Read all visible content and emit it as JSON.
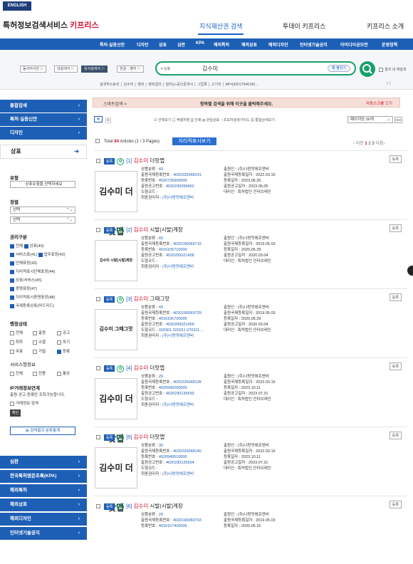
{
  "topbar": {
    "lang": "ENGLISH"
  },
  "header": {
    "logo_main": "특허정보검색서비스",
    "logo_brand": "키프리스",
    "nav": [
      "지식재산권 검색",
      "투데이 키프리스",
      "키프리스 소개"
    ]
  },
  "menubar": {
    "items": [
      "특허·실용신안",
      "디자인",
      "상표",
      "심판",
      "KPA",
      "해외특허",
      "해외상표",
      "해외디자인",
      "인터넷기술공지",
      "아이디어공모전",
      "운영정책"
    ]
  },
  "search": {
    "scopes": [
      "동의어사전 ▷",
      "내검색식 ▷",
      "유사검색식 ▷",
      "한글→영어 ▷"
    ],
    "field_select": "▾ 상표",
    "query": "김수미",
    "expand": "확 펼치기",
    "in_result": "결과 내 재검색",
    "history": "검색히스토리 │ 김수미 │ 영락 │ 영락걸리 │ 덜리는•공인중개사 │ 그립톡 │ 고기리 │ AP=[42017044190...",
    "history_nav": "〈 〉"
  },
  "sidebar": {
    "top_items": [
      "통합검색",
      "특허·실용신안",
      "디자인"
    ],
    "active": "상표",
    "type_title": "유형",
    "type_select": "상표유형을 선택하세요",
    "sort_title": "정렬",
    "sort1": "선택",
    "sort2": "선택",
    "rights_title": "권리구분",
    "rights": [
      [
        "전체",
        "상표(40)"
      ],
      [
        "서비스표(41)",
        "업무표장(42)"
      ],
      [
        "단체표장(43)"
      ],
      [
        "지리적표시단체표장(44)"
      ],
      [
        "상표/서비스(45)"
      ],
      [
        "증명표장(47)"
      ],
      [
        "지리적표시증명표장(48)"
      ],
      [
        "국제등록상표(마드리드)"
      ]
    ],
    "status_title": "행정상태",
    "status": [
      [
        "전체",
        "출원",
        "공고"
      ],
      [
        "취하",
        "소멸",
        "포기"
      ],
      [
        "무효",
        "거절",
        "등록"
      ]
    ],
    "design_title": "서비스형정보",
    "design": [
      "전체",
      "전용",
      "통상"
    ],
    "ip_title": "IP거래정보연계",
    "ip_desc": "출원·공고·등록만 조회가능합니다.",
    "ip_check": "거래정보 검색",
    "confirm": "확인",
    "stat_btn": "검색결과 분류통계",
    "bottom_items": [
      "심판",
      "한국특허영문초록(KPA)",
      "해외특허",
      "해외상표",
      "해외디자인",
      "인터넷기술공지"
    ]
  },
  "main": {
    "banner_left": "스마트검색 >",
    "banner_center": "항목별 검색을 위해 이곳을 클릭해주세요.",
    "banner_right": "자동스크롤 끄기",
    "tool_links": "☑ 선택보기 ▤ 엑셀저장 ⎙ 인쇄 ◍ 관심상표 ◔ 초보자검색가이드 ▦ 통합상세보기",
    "per_page": "페이지당 30개",
    "go": "GO",
    "total_prefix": "Total ",
    "total_count": "84",
    "total_suffix": " Articles (1 / 3 Pages)",
    "img_view": "지리적표시보기",
    "pager_prev": "‹ 이전",
    "pager_pages": "1",
    "pager_more": " 2 3",
    "pager_next": " 다음›"
  },
  "records": [
    {
      "num": "[1]",
      "name": "김수미",
      "rest": " 더맛맵",
      "status": "등록",
      "thumb": "김수미 더맛맵",
      "left": [
        [
          "상품분류 : ",
          "43"
        ],
        [
          "출원국제등록번호 : ",
          "4020220048141"
        ],
        [
          "등록번호 : ",
          "4020725600000"
        ],
        [
          "출원공고번호 : ",
          "4020230099462"
        ],
        [
          "도형코드 : ",
          ""
        ],
        [
          "최종권리자 : ",
          "(주)나랑맛에프앤비"
        ]
      ],
      "right": [
        [
          "출원인 : ",
          "(주)나랑맛에프앤비"
        ],
        [
          "출원국제등록일자 : ",
          "2022.03.16"
        ],
        [
          "등록일자 : ",
          "2023.06.25"
        ],
        [
          "출원공고일자 : ",
          "2023.06.05"
        ],
        [
          "대리인 : ",
          "특허법인 인터브레인"
        ]
      ]
    },
    {
      "num": "[2]",
      "name": "김수미",
      "rest": " 시발(시발)계장",
      "status": "등록",
      "thumb": "김수미 시발(시발)계장",
      "left": [
        [
          "상품분류 : ",
          "43"
        ],
        [
          "출원국제등록번호 : ",
          "4020190069715"
        ],
        [
          "등록번호 : ",
          "4016105710000"
        ],
        [
          "출원공고번호 : ",
          "4020200021458"
        ],
        [
          "도형코드 : ",
          ""
        ],
        [
          "최종권리자 : ",
          "(주)나랑맛에프앤비"
        ]
      ],
      "right": [
        [
          "출원인 : ",
          "(주)나랑맛에프앤비"
        ],
        [
          "출원국제등록일자 : ",
          "2019.05.03"
        ],
        [
          "등록일자 : ",
          "2020.05.29"
        ],
        [
          "출원공고일자 : ",
          "2020.03.04"
        ],
        [
          "대리인 : ",
          "특허법인 인터브레인"
        ]
      ]
    },
    {
      "num": "[3]",
      "name": "김수미",
      "rest": " 그때그맛",
      "status": "등록",
      "thumb": "김수미 그때그맛",
      "left": [
        [
          "상품분류 : ",
          "43"
        ],
        [
          "출원국제등록번호 : ",
          "4020190069729"
        ],
        [
          "등록번호 : ",
          "4016105720000"
        ],
        [
          "출원공고번호 : ",
          "4020200021459"
        ],
        [
          "도형코드 : ",
          "020301 020311 070311 ..."
        ],
        [
          "최종권리자 : ",
          "(주)나랑맛에프앤비"
        ]
      ],
      "right": [
        [
          "출원인 : ",
          "(주)나랑맛에프앤비"
        ],
        [
          "출원국제등록일자 : ",
          "2019.05.03"
        ],
        [
          "등록일자 : ",
          "2020.05.29"
        ],
        [
          "출원공고일자 : ",
          "2020.03.04"
        ],
        [
          "대리인 : ",
          "특허법인 인터브레인"
        ]
      ]
    },
    {
      "num": "[4]",
      "name": "김수미",
      "rest": " 더맛맵",
      "status": "등록",
      "thumb": "김수미 더맛맵",
      "left": [
        [
          "상품분류 : ",
          "29"
        ],
        [
          "출원국제등록번호 : ",
          "4020220048139"
        ],
        [
          "등록번호 : ",
          "4020949290000"
        ],
        [
          "출원공고번호 : ",
          "4020230135593"
        ],
        [
          "도형코드 : ",
          ""
        ],
        [
          "최종권리자 : ",
          "(주)나랑맛에프앤비"
        ]
      ],
      "right": [
        [
          "출원인 : ",
          "(주)나랑맛에프앤비"
        ],
        [
          "출원국제등록일자 : ",
          "2022.03.16"
        ],
        [
          "등록일자 : ",
          "2023.10.11"
        ],
        [
          "출원공고일자 : ",
          "2023.07.31"
        ],
        [
          "대리인 : ",
          "특허법인 인터브레인"
        ]
      ]
    },
    {
      "num": "[5]",
      "name": "김수미",
      "rest": " 더맛맵",
      "status": "등록",
      "thumb": "김수미 더맛맵",
      "left": [
        [
          "상품분류 : ",
          "30"
        ],
        [
          "출원국제등록번호 : ",
          "4020220048140"
        ],
        [
          "등록번호 : ",
          "4020949510000"
        ],
        [
          "출원공고번호 : ",
          "4020230135594"
        ],
        [
          "도형코드 : ",
          ""
        ],
        [
          "최종권리자 : ",
          "(주)나랑맛에프앤비"
        ]
      ],
      "right": [
        [
          "출원인 : ",
          "(주)나랑맛에프앤비"
        ],
        [
          "출원국제등록일자 : ",
          "2022.03.16"
        ],
        [
          "등록일자 : ",
          "2023.10.11"
        ],
        [
          "출원공고일자 : ",
          "2023.07.31"
        ],
        [
          "대리인 : ",
          "특허법인 인터브레인"
        ]
      ]
    },
    {
      "num": "[6]",
      "name": "김수미",
      "rest": " 시발(시발)계장",
      "status": "등록",
      "thumb": "",
      "left": [
        [
          "상품분류 : ",
          "29"
        ],
        [
          "출원국제등록번호 : ",
          "4020190069703"
        ],
        [
          "등록번호 : ",
          "4016157420000"
        ]
      ],
      "right": [
        [
          "출원인 : ",
          "(주)나랑맛에프앤비"
        ],
        [
          "출원국제등록일자 : ",
          "2019.05.03"
        ],
        [
          "등록일자 : ",
          "2020.06.15"
        ]
      ]
    }
  ],
  "colors": {
    "brand": "#1e5fb6",
    "accent": "#d6102f",
    "search": "#1aa06b"
  }
}
